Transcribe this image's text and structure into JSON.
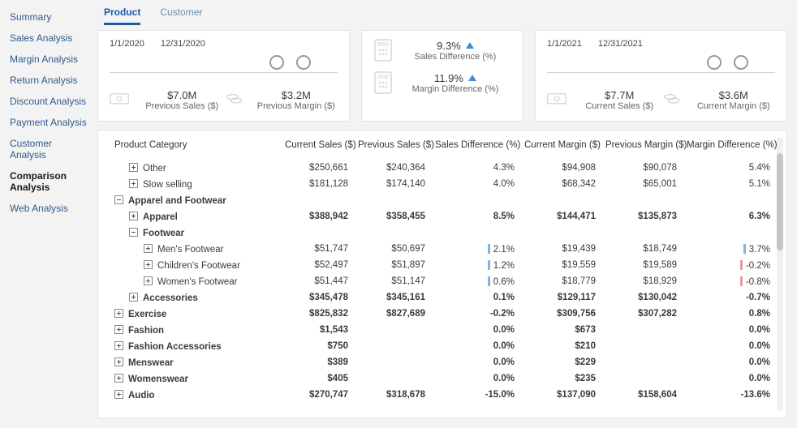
{
  "sidebar": {
    "items": [
      {
        "label": "Summary"
      },
      {
        "label": "Sales Analysis"
      },
      {
        "label": "Margin Analysis"
      },
      {
        "label": "Return Analysis"
      },
      {
        "label": "Discount Analysis"
      },
      {
        "label": "Payment Analysis"
      },
      {
        "label": "Customer Analysis"
      },
      {
        "label": "Comparison Analysis"
      },
      {
        "label": "Web Analysis"
      }
    ],
    "active_index": 7
  },
  "tabs": [
    {
      "label": "Product"
    },
    {
      "label": "Customer"
    }
  ],
  "active_tab": 0,
  "period_prev": {
    "start": "1/1/2020",
    "end": "12/31/2020",
    "slider_from_pct": 70,
    "slider_to_pct": 82,
    "sales_value": "$7.0M",
    "sales_label": "Previous Sales ($)",
    "margin_value": "$3.2M",
    "margin_label": "Previous Margin ($)"
  },
  "period_curr": {
    "start": "1/1/2021",
    "end": "12/31/2021",
    "slider_from_pct": 70,
    "slider_to_pct": 82,
    "sales_value": "$7.7M",
    "sales_label": "Current Sales ($)",
    "margin_value": "$3.6M",
    "margin_label": "Current Margin ($)"
  },
  "diff": {
    "sales_value": "9.3%",
    "sales_label": "Sales Difference (%)",
    "margin_value": "11.9%",
    "margin_label": "Margin Difference (%)"
  },
  "table": {
    "headers": {
      "category": "Product Category",
      "curr_sales": "Current Sales ($)",
      "prev_sales": "Previous Sales ($)",
      "sales_diff": "Sales Difference (%)",
      "curr_margin": "Current Margin ($)",
      "prev_margin": "Previous Margin ($)",
      "margin_diff": "Margin Difference (%)"
    },
    "rows": [
      {
        "indent": 1,
        "exp": "plus",
        "label": "Other",
        "cs": "$250,661",
        "ps": "$240,364",
        "sd": "4.3%",
        "cm": "$94,908",
        "pm": "$90,078",
        "md": "5.4%"
      },
      {
        "indent": 1,
        "exp": "plus",
        "label": "Slow selling",
        "cs": "$181,128",
        "ps": "$174,140",
        "sd": "4.0%",
        "cm": "$68,342",
        "pm": "$65,001",
        "md": "5.1%"
      },
      {
        "indent": 0,
        "exp": "minus",
        "bold": true,
        "label": "Apparel and Footwear"
      },
      {
        "indent": 1,
        "exp": "plus",
        "bold": true,
        "label": "Apparel",
        "cs": "$388,942",
        "ps": "$358,455",
        "sd": "8.5%",
        "cm": "$144,471",
        "pm": "$135,873",
        "md": "6.3%"
      },
      {
        "indent": 1,
        "exp": "minus",
        "bold": true,
        "label": "Footwear"
      },
      {
        "indent": 2,
        "exp": "plus",
        "label": "Men's Footwear",
        "cs": "$51,747",
        "ps": "$50,697",
        "sd": "2.1%",
        "sdbar": "blue",
        "cm": "$19,439",
        "pm": "$18,749",
        "md": "3.7%",
        "mdbar": "blue"
      },
      {
        "indent": 2,
        "exp": "plus",
        "label": "Children's Footwear",
        "cs": "$52,497",
        "ps": "$51,897",
        "sd": "1.2%",
        "sdbar": "blue",
        "cm": "$19,559",
        "pm": "$19,589",
        "md": "-0.2%",
        "mdbar": "red"
      },
      {
        "indent": 2,
        "exp": "plus",
        "label": "Women's Footwear",
        "cs": "$51,447",
        "ps": "$51,147",
        "sd": "0.6%",
        "sdbar": "blue",
        "cm": "$18,779",
        "pm": "$18,929",
        "md": "-0.8%",
        "mdbar": "red"
      },
      {
        "indent": 1,
        "exp": "plus",
        "bold": true,
        "label": "Accessories",
        "cs": "$345,478",
        "ps": "$345,161",
        "sd": "0.1%",
        "cm": "$129,117",
        "pm": "$130,042",
        "md": "-0.7%"
      },
      {
        "indent": 0,
        "exp": "plus",
        "bold": true,
        "label": "Exercise",
        "cs": "$825,832",
        "ps": "$827,689",
        "sd": "-0.2%",
        "cm": "$309,756",
        "pm": "$307,282",
        "md": "0.8%"
      },
      {
        "indent": 0,
        "exp": "plus",
        "bold": true,
        "label": "Fashion",
        "cs": "$1,543",
        "ps": "",
        "sd": "0.0%",
        "cm": "$673",
        "pm": "",
        "md": "0.0%"
      },
      {
        "indent": 0,
        "exp": "plus",
        "bold": true,
        "label": "Fashion Accessories",
        "cs": "$750",
        "ps": "",
        "sd": "0.0%",
        "cm": "$210",
        "pm": "",
        "md": "0.0%"
      },
      {
        "indent": 0,
        "exp": "plus",
        "bold": true,
        "label": "Menswear",
        "cs": "$389",
        "ps": "",
        "sd": "0.0%",
        "cm": "$229",
        "pm": "",
        "md": "0.0%"
      },
      {
        "indent": 0,
        "exp": "plus",
        "bold": true,
        "label": "Womenswear",
        "cs": "$405",
        "ps": "",
        "sd": "0.0%",
        "cm": "$235",
        "pm": "",
        "md": "0.0%"
      },
      {
        "indent": 0,
        "exp": "plus",
        "bold": true,
        "label": "Audio",
        "cs": "$270,747",
        "ps": "$318,678",
        "sd": "-15.0%",
        "cm": "$137,090",
        "pm": "$158,604",
        "md": "-13.6%"
      }
    ]
  }
}
